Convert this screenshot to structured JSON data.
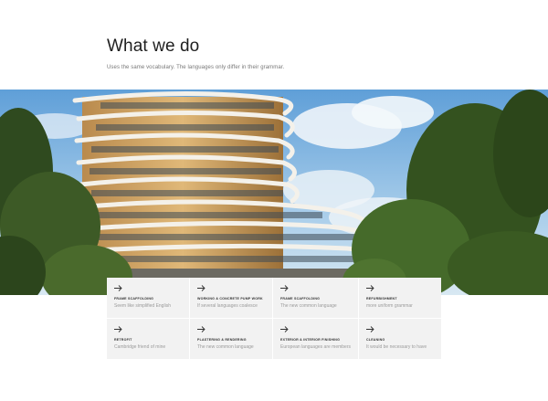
{
  "section": {
    "title": "What we do",
    "subtitle": "Uses the same vocabulary. The languages only differ in their grammar."
  },
  "hero": {
    "image": "apartment-building-among-trees"
  },
  "services": [
    {
      "icon": "arrow-right-icon",
      "title": "FRAME SCAFFOLDING",
      "text": "Seem like simplified English"
    },
    {
      "icon": "arrow-right-icon",
      "title": "WORKING & CONCRETE PUMP WORK",
      "text": "If several languages coalesce"
    },
    {
      "icon": "arrow-right-icon",
      "title": "FRAME SCAFFOLDING",
      "text": "The new common language"
    },
    {
      "icon": "arrow-right-icon",
      "title": "REFURBISHMENT",
      "text": "more uniform grammar"
    },
    {
      "icon": "arrow-right-icon",
      "title": "RETROFIT",
      "text": "Cambridge friend of mine"
    },
    {
      "icon": "arrow-right-icon",
      "title": "PLASTERING & RENDERING",
      "text": "The new common language"
    },
    {
      "icon": "arrow-right-icon",
      "title": "EXTERIOR & INTERIOR FINISHING",
      "text": "European languages are members"
    },
    {
      "icon": "arrow-right-icon",
      "title": "CLEANING",
      "text": "It would be necessary to have"
    }
  ],
  "colors": {
    "card_bg": "#f2f2f2",
    "title": "#1f1f1f",
    "muted": "#9a9a9a"
  }
}
